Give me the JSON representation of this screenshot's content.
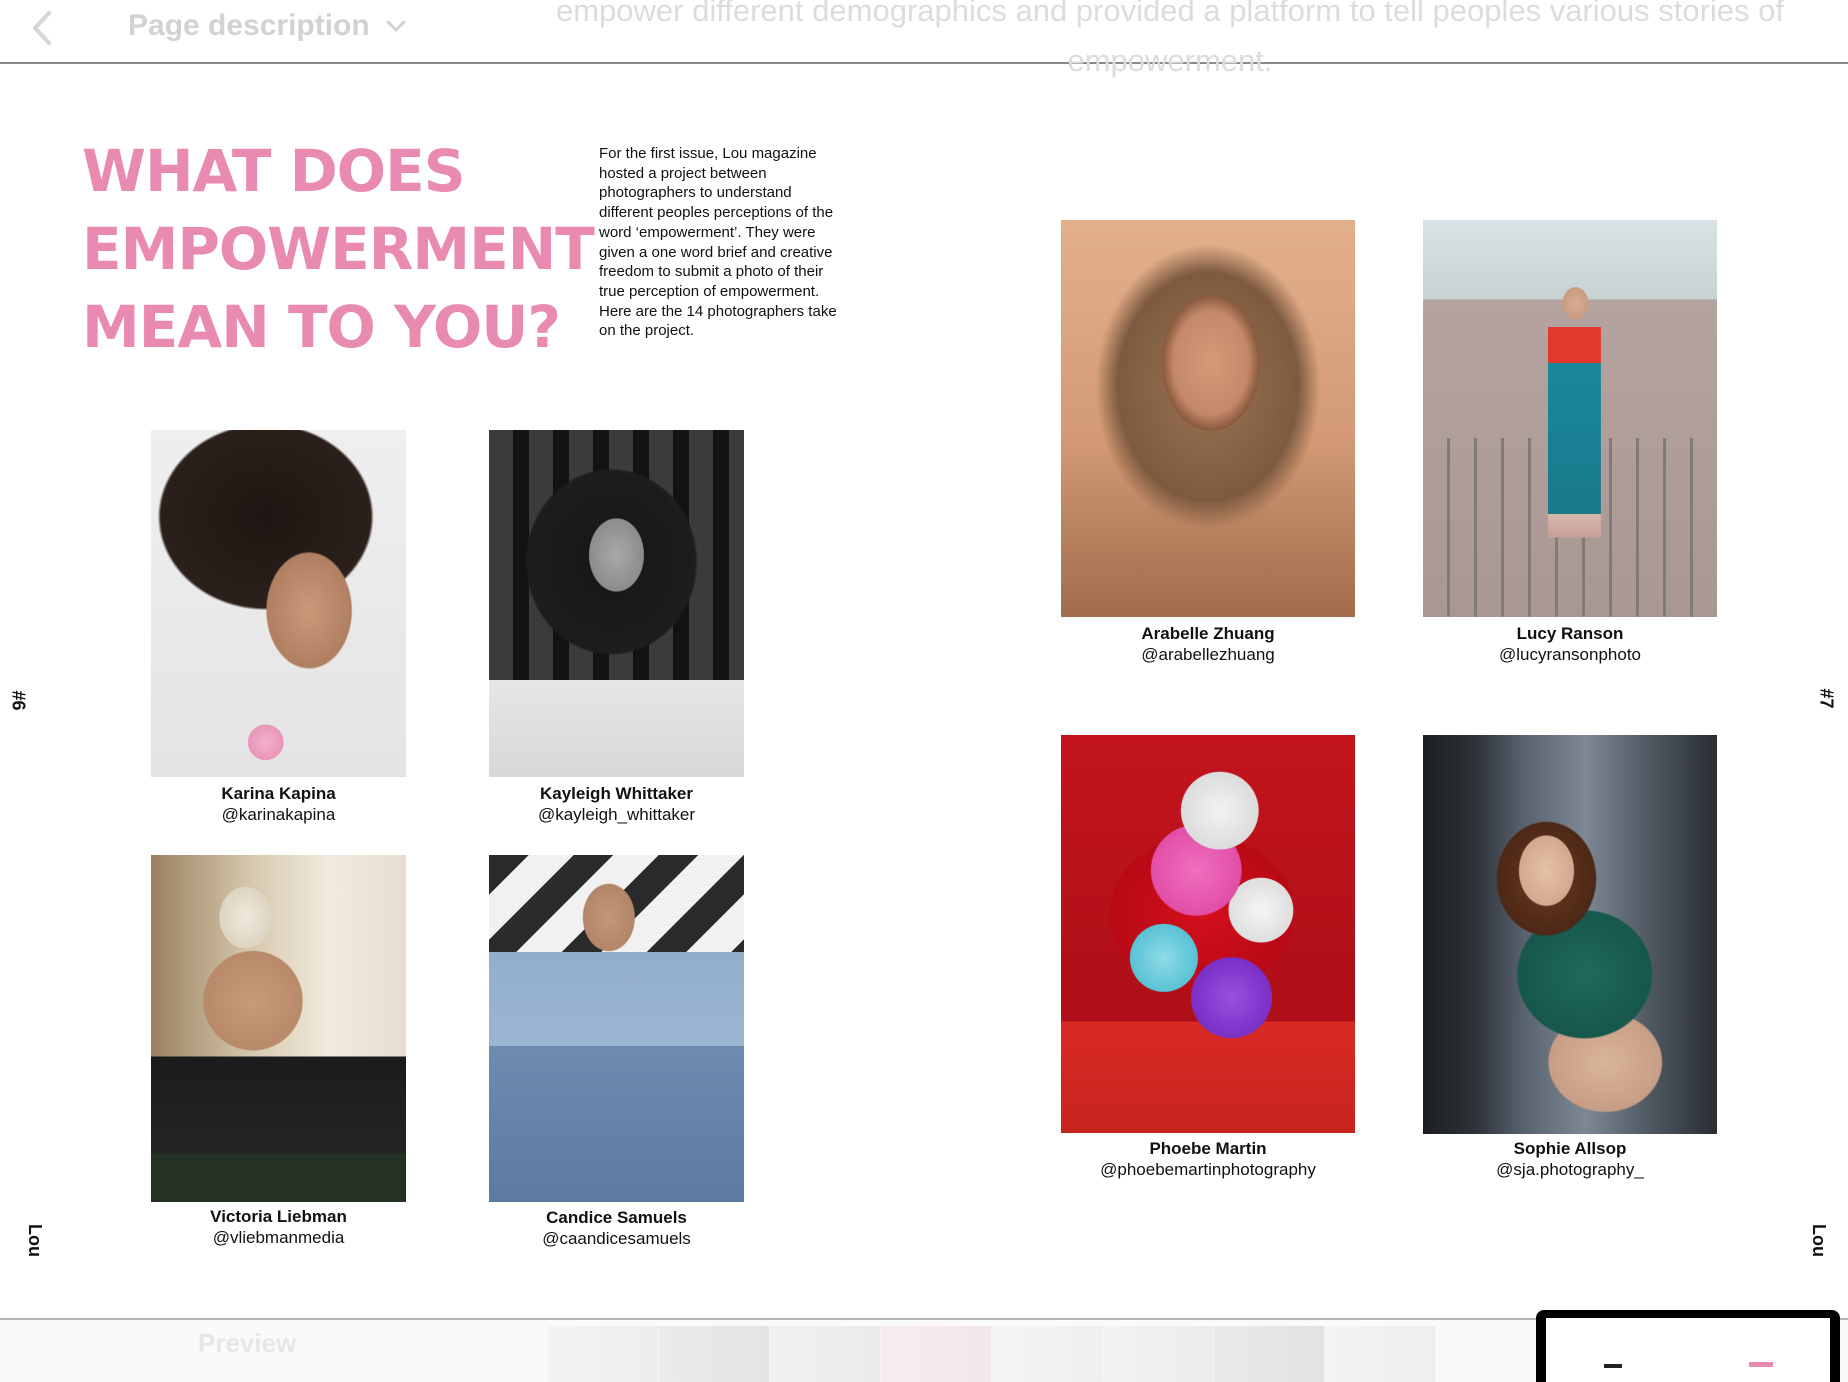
{
  "toolbar": {
    "page_description_label": "Page description",
    "background_text_line1": "empower different demographics and provided a platform to tell peoples various stories of",
    "background_text_line2": "empowerment."
  },
  "spread": {
    "headline": [
      "WHAT DOES",
      "EMPOWERMENT",
      "MEAN TO YOU?"
    ],
    "intro": "For the first issue, Lou magazine hosted a project between photographers to understand different peoples perceptions of the word ‘empowerment’. They were given a one word brief and creative freedom to submit a photo of their true perception of empowerment. Here are the 14 photographers take on the project.",
    "left_page_number": "#6",
    "right_page_number": "#7",
    "left_brand": "Lou",
    "right_brand": "Lou",
    "photographers": [
      {
        "name": "Karina Kapina",
        "handle": "@karinakapina"
      },
      {
        "name": "Kayleigh Whittaker",
        "handle": "@kayleigh_whittaker"
      },
      {
        "name": "Victoria Liebman",
        "handle": "@vliebmanmedia"
      },
      {
        "name": "Candice Samuels",
        "handle": "@caandicesamuels"
      },
      {
        "name": "Arabelle Zhuang",
        "handle": "@arabellezhuang"
      },
      {
        "name": "Lucy Ranson",
        "handle": "@lucyransonphoto"
      },
      {
        "name": "Phoebe Martin",
        "handle": "@phoebemartinphotography"
      },
      {
        "name": "Sophie Allsop",
        "handle": "@sja.photography_"
      }
    ]
  },
  "bottombar": {
    "preview_label": "Preview"
  },
  "colors": {
    "headline_pink": "#e98bb0"
  }
}
